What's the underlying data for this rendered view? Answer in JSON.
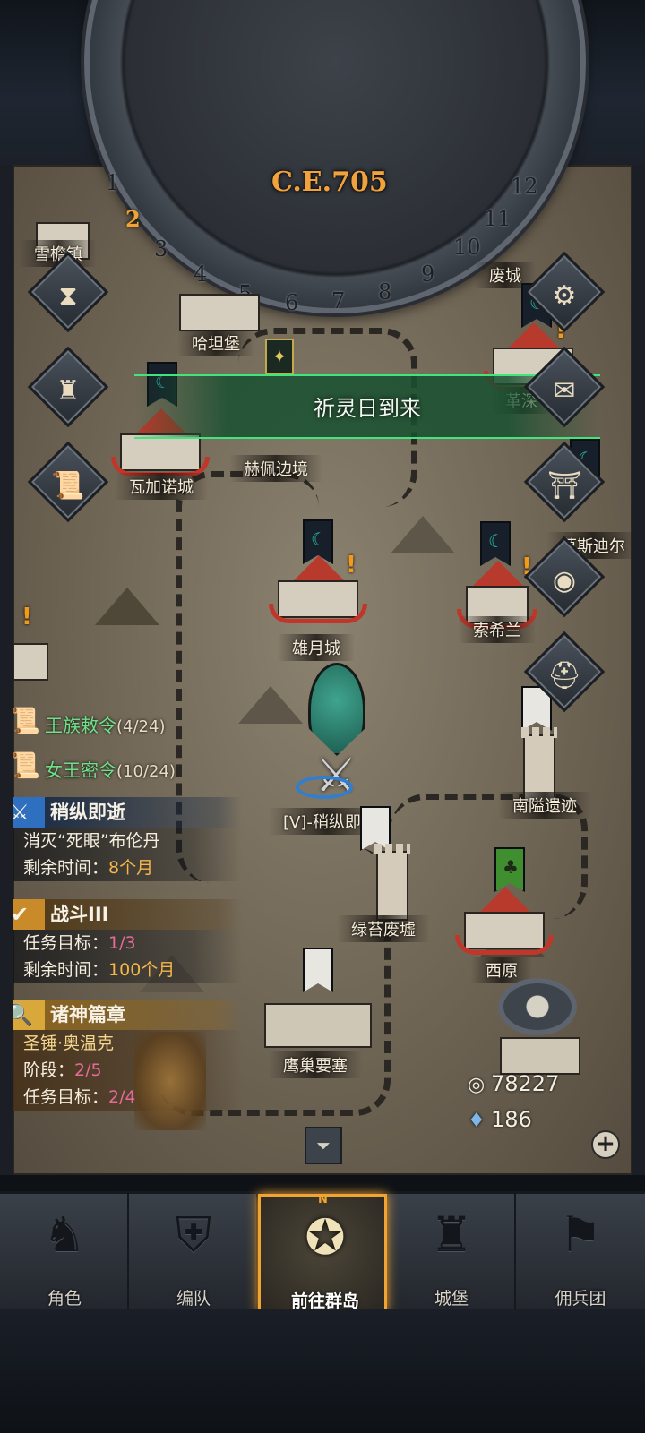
{
  "calendar": {
    "year": "C.E.705",
    "months": [
      "1",
      "2",
      "3",
      "4",
      "5",
      "6",
      "7",
      "8",
      "9",
      "10",
      "11",
      "12"
    ],
    "current_month": "2"
  },
  "event": {
    "title": "祈灵日到来"
  },
  "locations": {
    "l1": "雪檐镇",
    "l2": "哈坦堡",
    "l3": "废城",
    "l4": "革深",
    "l5": "赫佩边境",
    "l6": "瓦加诺城",
    "l7": "莫斯迪尔",
    "l8": "雄月城",
    "l9": "索希兰",
    "l10": "[V]-稍纵即逝",
    "l11": "南隘遗迹",
    "l12": "绿苔废墟",
    "l13": "西原",
    "l14": "鹰巢要塞"
  },
  "side_buttons": {
    "time": "hourglass-icon",
    "bag": "bag-icon",
    "scroll": "scroll-icon",
    "settings": "gear-icon",
    "mail": "mail-icon",
    "gate": "gate-icon",
    "coin": "coin-icon",
    "helmet": "helmet-icon",
    "target": "target-icon"
  },
  "quest_docs": [
    {
      "label": "王族敕令",
      "count": "(4/24)"
    },
    {
      "label": "女王密令",
      "count": "(10/24)"
    }
  ],
  "tasks": {
    "fleeting": {
      "title": "稍纵即逝",
      "desc": "消灭“死眼”布伦丹",
      "time_label": "剩余时间：",
      "time_value": "8个月",
      "color": "#2e6fc0"
    },
    "battle": {
      "title": "战斗III",
      "goal_label": "任务目标：",
      "goal_value": "1/3",
      "time_label": "剩余时间：",
      "time_value": "100个月",
      "color": "#c98a2a"
    },
    "gods": {
      "title": "诸神篇章",
      "subtitle": "圣锤·奥温克",
      "stage_label": "阶段：",
      "stage_value": "2/5",
      "goal_label": "任务目标：",
      "goal_value": "2/4",
      "color": "#d8a93a"
    }
  },
  "resources": {
    "silver": "78227",
    "crystal": "186"
  },
  "nav": [
    {
      "label": "角色",
      "icon": "knight-icon"
    },
    {
      "label": "编队",
      "icon": "helmet-icon"
    },
    {
      "label": "前往群岛",
      "icon": "compass-map-icon",
      "compass_n": "N",
      "active": true
    },
    {
      "label": "城堡",
      "icon": "castle-icon"
    },
    {
      "label": "佣兵团",
      "icon": "mercenary-icon"
    }
  ],
  "colors": {
    "accent": "#f1a431",
    "event_green": "#3ee67c",
    "quest_green": "#6fe08a"
  }
}
